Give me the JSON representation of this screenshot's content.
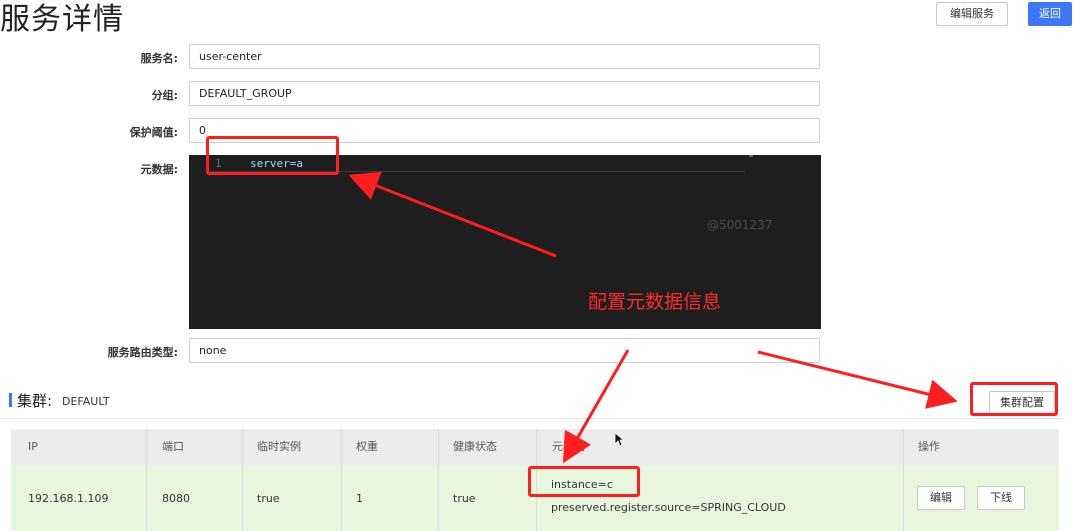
{
  "header": {
    "title": "服务详情",
    "edit_service_label": "编辑服务",
    "back_label": "返回"
  },
  "form": {
    "service_name_label": "服务名:",
    "service_name_value": "user-center",
    "group_label": "分组:",
    "group_value": "DEFAULT_GROUP",
    "threshold_label": "保护阈值:",
    "threshold_value": "0",
    "metadata_label": "元数据:",
    "metadata_line_number": "1",
    "metadata_code": "server=a",
    "route_type_label": "服务路由类型:",
    "route_type_value": "none"
  },
  "watermark": "@5001237",
  "annotation": {
    "text": "配置元数据信息",
    "color": "#ff2a2a"
  },
  "cluster": {
    "label": "集群:",
    "name": "DEFAULT",
    "config_button_label": "集群配置"
  },
  "table": {
    "headers": [
      "IP",
      "端口",
      "临时实例",
      "权重",
      "健康状态",
      "元数据",
      "操作"
    ],
    "rows": [
      {
        "ip": "192.168.1.109",
        "port": "8080",
        "ephemeral": "true",
        "weight": "1",
        "healthy": "true",
        "metadata_line1": "instance=c",
        "metadata_line2": "preserved.register.source=SPRING_CLOUD",
        "edit_label": "编辑",
        "offline_label": "下线"
      }
    ]
  },
  "colors": {
    "primary": "#3b78f5",
    "highlight": "#ff1e1e",
    "row_bg": "#e7f6dc",
    "editor_bg": "#1e1e1e"
  }
}
